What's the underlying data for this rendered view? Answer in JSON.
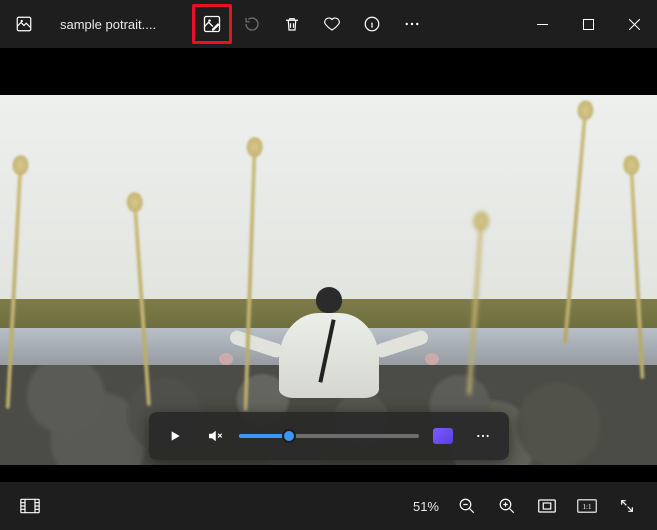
{
  "tab": {
    "title": "sample potrait...."
  },
  "toolbar": {
    "edit": "edit-image",
    "rotate": "rotate",
    "delete": "delete",
    "favorite": "favorite",
    "info": "info",
    "more": "more"
  },
  "window": {
    "minimize": "minimize",
    "maximize": "maximize",
    "close": "close"
  },
  "media": {
    "play": "play",
    "mute": "mute",
    "progress_pct": 28,
    "clip": "clip",
    "more": "more"
  },
  "status": {
    "filmstrip": "filmstrip",
    "zoom_pct": "51%",
    "zoom_out": "zoom-out",
    "zoom_in": "zoom-in",
    "fit": "fit",
    "actual": "actual-size",
    "fullscreen": "fullscreen"
  }
}
